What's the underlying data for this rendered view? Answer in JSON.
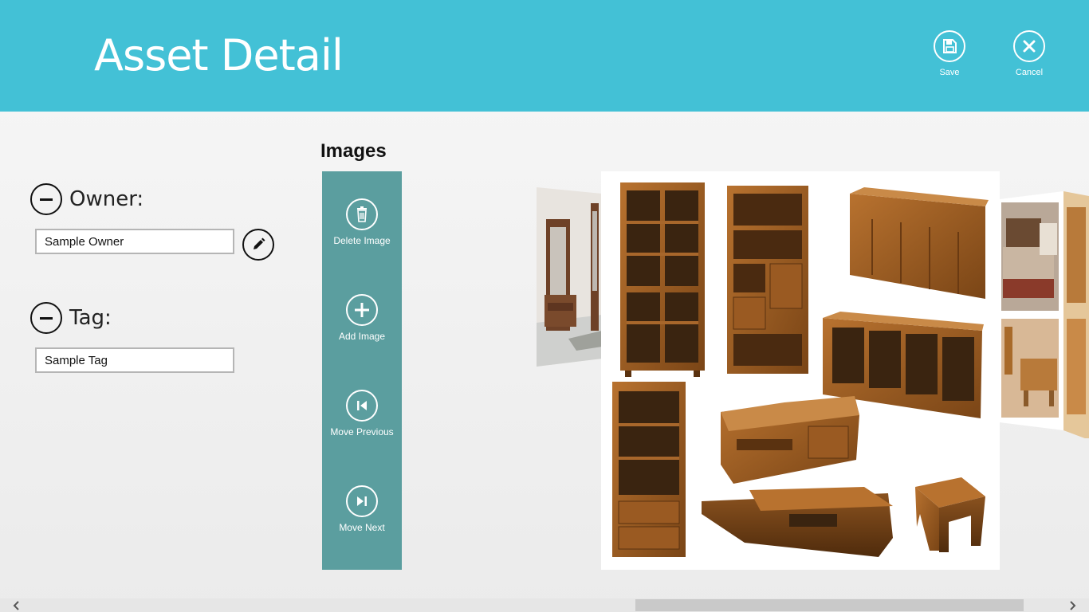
{
  "header": {
    "title": "Asset Detail",
    "background_color": "#43c1d6",
    "buttons": [
      {
        "label": "Save",
        "icon": "save-icon"
      },
      {
        "label": "Cancel",
        "icon": "close-icon"
      }
    ]
  },
  "form": {
    "owner": {
      "label": "Owner:",
      "value": "Sample Owner",
      "remove_icon": "minus-icon",
      "edit_icon": "pencil-icon"
    },
    "tag": {
      "label": "Tag:",
      "value": "Sample Tag",
      "remove_icon": "minus-icon"
    }
  },
  "images": {
    "heading": "Images",
    "toolbar_color": "#5b9e9f",
    "actions": [
      {
        "label": "Delete Image",
        "icon": "trash-icon"
      },
      {
        "label": "Add Image",
        "icon": "plus-icon"
      },
      {
        "label": "Move Previous",
        "icon": "skip-previous-icon"
      },
      {
        "label": "Move Next",
        "icon": "skip-next-icon"
      }
    ],
    "current_image": "wooden-furniture-collection",
    "previous_image": "hallway-mirror-cabinet",
    "next_image": "bedroom-furniture"
  },
  "scrollbar": {
    "left_icon": "chevron-left-icon",
    "right_icon": "chevron-right-icon",
    "position_fraction": 0.6
  }
}
